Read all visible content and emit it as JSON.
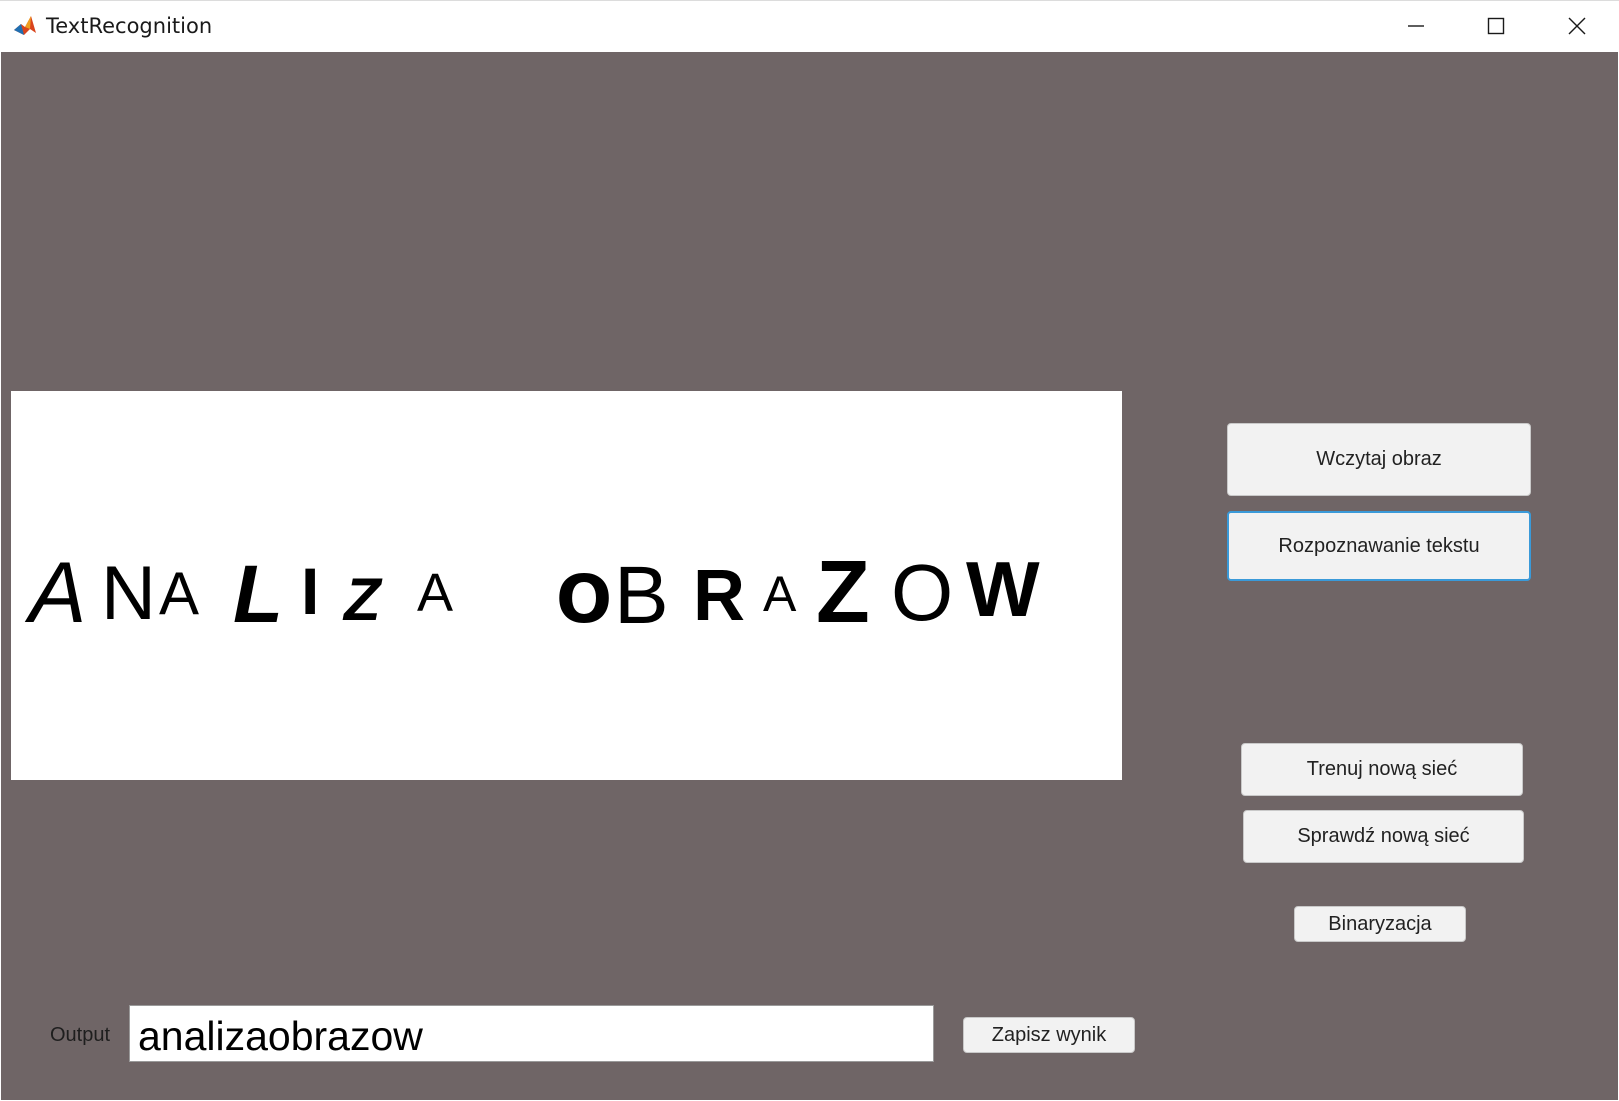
{
  "window": {
    "title": "TextRecognition",
    "app_icon": "matlab-icon",
    "controls": [
      "minimize-icon",
      "maximize-icon",
      "close-icon"
    ]
  },
  "image_panel": {
    "word1": [
      "A",
      "N",
      "A",
      "L",
      "I",
      "Z",
      "A"
    ],
    "word2": [
      "O",
      "B",
      "R",
      "A",
      "Z",
      "O",
      "W"
    ]
  },
  "buttons": {
    "load_image": "Wczytaj obraz",
    "recognize_text": "Rozpoznawanie tekstu",
    "train_network": "Trenuj nową sieć",
    "check_network": "Sprawdź nową sieć",
    "binarization": "Binaryzacja",
    "save_result": "Zapisz wynik"
  },
  "output": {
    "label": "Output",
    "value": "analizaobrazow"
  },
  "colors": {
    "background": "#6f6566",
    "focus_border": "#3a9ad9",
    "button_face": "#f2f2f2"
  }
}
